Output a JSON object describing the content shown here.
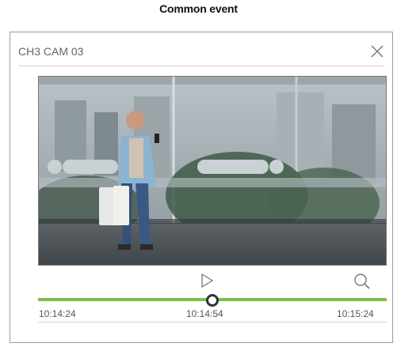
{
  "caption": "Common event",
  "dialog": {
    "title": "CH3 CAM 03",
    "close_icon": "close-icon"
  },
  "player": {
    "play_icon": "play-icon",
    "zoom_icon": "search-icon",
    "timeline": {
      "start": "10:14:24",
      "current": "10:14:54",
      "end": "10:15:24",
      "position": 0.5,
      "color": "#7cbf45"
    }
  }
}
